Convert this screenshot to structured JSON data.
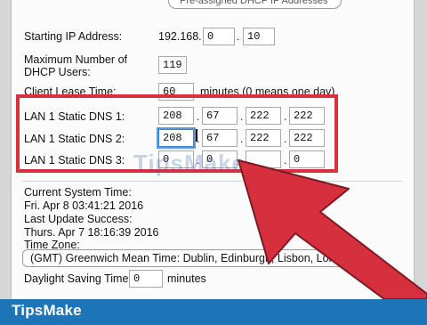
{
  "top_select": {
    "value": "Pre-assigned DHCP IP Addresses"
  },
  "dhcp": {
    "starting_ip_label": "Starting IP Address:",
    "starting_ip_prefix": "192.168.",
    "starting_ip_oct3": "0",
    "starting_ip_oct4": "10",
    "max_users_label_line1": "Maximum Number of",
    "max_users_label_line2": "DHCP Users:",
    "max_users_value": "119",
    "lease_label": "Client Lease Time:",
    "lease_value": "60",
    "lease_suffix": "minutes (0 means one day)"
  },
  "dns": {
    "dns1_label": "LAN 1 Static DNS 1:",
    "dns1": [
      "208",
      "67",
      "222",
      "222"
    ],
    "dns2_label": "LAN 1 Static DNS 2:",
    "dns2": [
      "208",
      "67",
      "222",
      "222"
    ],
    "dns3_label": "LAN 1 Static DNS 3:",
    "dns3": [
      "0",
      "0",
      "",
      "0"
    ]
  },
  "status": {
    "system_time_label": "Current System Time:",
    "system_time_value": "Fri. Apr 8 03:41:21 2016",
    "last_update_label": "Last Update Success:",
    "last_update_value": "Thurs. Apr 7 18:16:39 2016",
    "timezone_label": "Time Zone:",
    "timezone_value": "(GMT) Greenwich Mean Time: Dublin, Edinburgh, Lisbon, London",
    "dst_label": "Daylight Saving Time",
    "dst_value": "0",
    "dst_suffix": "minutes"
  },
  "brand": {
    "name": "TipsMake",
    "watermark": "TipsMake"
  },
  "colors": {
    "highlight_box": "#d9303e",
    "arrow": "#d6303e",
    "brand_bar": "#1d74b6"
  }
}
